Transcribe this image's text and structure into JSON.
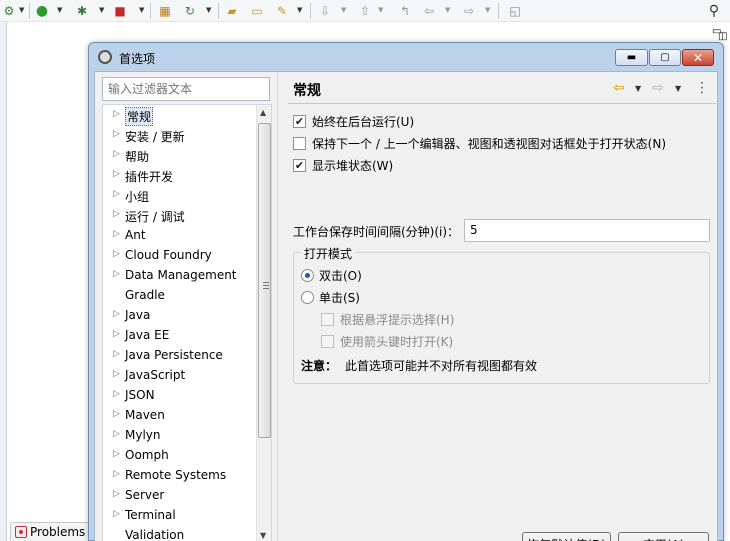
{
  "ide": {
    "toolbar_icons": [
      "gear-icon",
      "run-icon",
      "debug-icon",
      "external-tools-icon",
      "package-icon",
      "refresh-icon",
      "open-folder-icon",
      "folder-icon",
      "pin-icon",
      "next-annotation-icon",
      "prev-annotation-icon",
      "back-icon",
      "forward-icon",
      "restore-icon",
      "search-icon"
    ],
    "bottom_tab": "Problems"
  },
  "dialog": {
    "title": "首选项",
    "filter_placeholder": "输入过滤器文本",
    "tree_items": [
      {
        "label": "常规",
        "expandable": true,
        "selected": true
      },
      {
        "label": "安装 / 更新",
        "expandable": true
      },
      {
        "label": "帮助",
        "expandable": true
      },
      {
        "label": "插件开发",
        "expandable": true
      },
      {
        "label": "小组",
        "expandable": true
      },
      {
        "label": "运行 / 调试",
        "expandable": true
      },
      {
        "label": "Ant",
        "expandable": true
      },
      {
        "label": "Cloud Foundry",
        "expandable": true
      },
      {
        "label": "Data Management",
        "expandable": true
      },
      {
        "label": "Gradle",
        "expandable": false
      },
      {
        "label": "Java",
        "expandable": true
      },
      {
        "label": "Java EE",
        "expandable": true
      },
      {
        "label": "Java Persistence",
        "expandable": true
      },
      {
        "label": "JavaScript",
        "expandable": true
      },
      {
        "label": "JSON",
        "expandable": true
      },
      {
        "label": "Maven",
        "expandable": true
      },
      {
        "label": "Mylyn",
        "expandable": true
      },
      {
        "label": "Oomph",
        "expandable": true
      },
      {
        "label": "Remote Systems",
        "expandable": true
      },
      {
        "label": "Server",
        "expandable": true
      },
      {
        "label": "Terminal",
        "expandable": true
      },
      {
        "label": "Validation",
        "expandable": false
      }
    ],
    "page": {
      "title": "常规",
      "checkboxes": [
        {
          "label": "始终在后台运行(U)",
          "checked": true
        },
        {
          "label": "保持下一个 / 上一个编辑器、视图和透视图对话框处于打开状态(N)",
          "checked": false
        },
        {
          "label": "显示堆状态(W)",
          "checked": true
        }
      ],
      "interval_label": "工作台保存时间间隔(分钟)(i)：",
      "interval_value": "5",
      "open_mode": {
        "title": "打开模式",
        "double_click": "双击(O)",
        "single_click": "单击(S)",
        "hover_select": "根据悬浮提示选择(H)",
        "arrow_open": "使用箭头键时打开(K)",
        "selected": "double_click"
      },
      "note_label": "注意：",
      "note_text": "此首选项可能并不对所有视图都有效"
    },
    "buttons": {
      "restore_defaults": "恢复默认值(D)",
      "apply": "应用(A)"
    }
  }
}
